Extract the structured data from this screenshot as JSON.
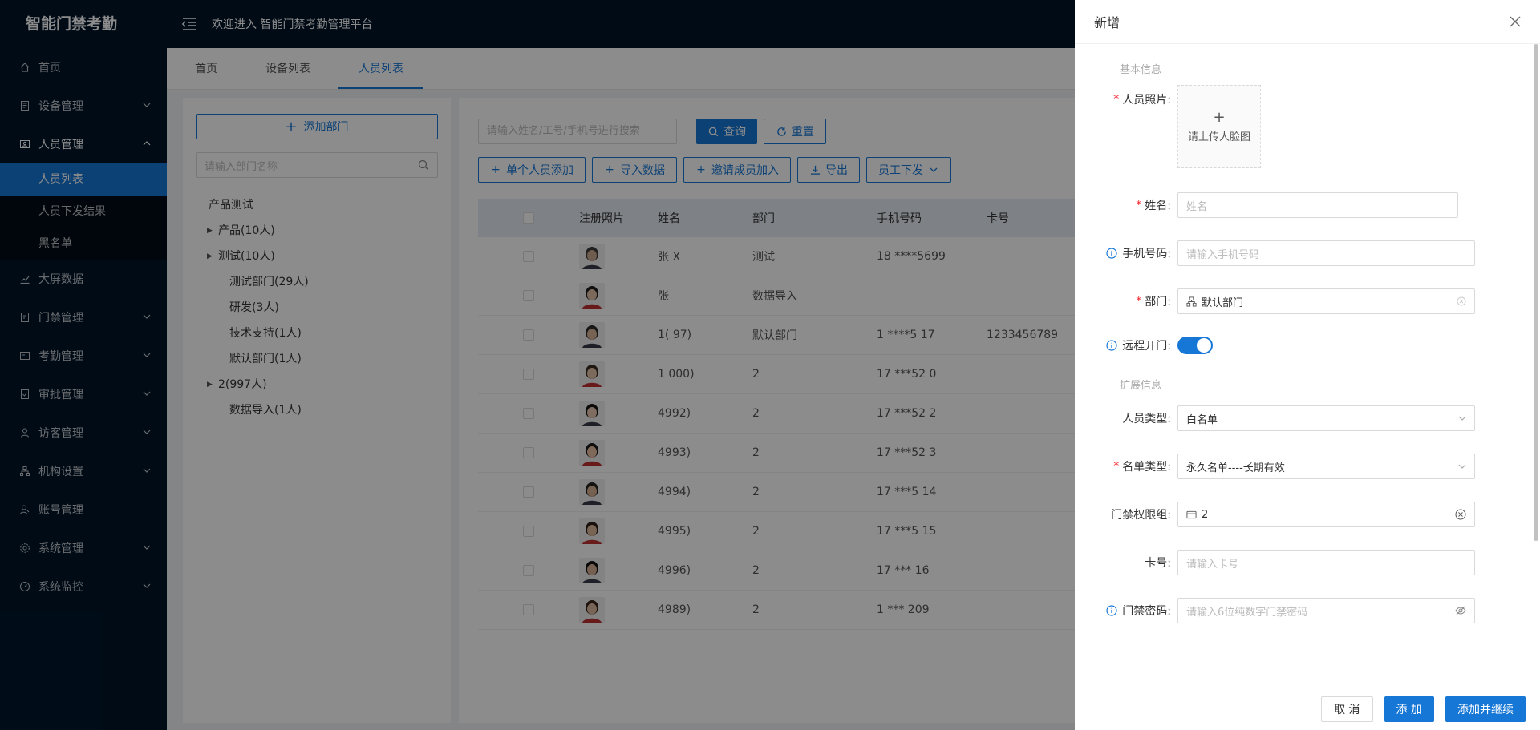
{
  "app_title": "智能门禁考勤",
  "header": {
    "welcome": "欢迎进入 智能门禁考勤管理平台"
  },
  "sidebar": {
    "items": [
      {
        "label": "首页",
        "icon": "home-icon"
      },
      {
        "label": "设备管理",
        "icon": "device-icon",
        "expandable": true
      },
      {
        "label": "人员管理",
        "icon": "person-card-icon",
        "expandable": true,
        "expanded": true,
        "children": [
          "人员列表",
          "人员下发结果",
          "黑名单"
        ]
      },
      {
        "label": "大屏数据",
        "icon": "chart-icon"
      },
      {
        "label": "门禁管理",
        "icon": "door-icon",
        "expandable": true
      },
      {
        "label": "考勤管理",
        "icon": "attendance-icon",
        "expandable": true
      },
      {
        "label": "审批管理",
        "icon": "approval-icon",
        "expandable": true
      },
      {
        "label": "访客管理",
        "icon": "visitor-icon",
        "expandable": true
      },
      {
        "label": "机构设置",
        "icon": "org-icon",
        "expandable": true
      },
      {
        "label": "账号管理",
        "icon": "account-icon"
      },
      {
        "label": "系统管理",
        "icon": "settings-icon",
        "expandable": true
      },
      {
        "label": "系统监控",
        "icon": "monitor-icon",
        "expandable": true
      }
    ],
    "active_child": "人员列表"
  },
  "tabs": [
    "首页",
    "设备列表",
    "人员列表"
  ],
  "active_tab": "人员列表",
  "dept_panel": {
    "add_button": "添加部门",
    "search_placeholder": "请输入部门名称",
    "root": "产品测试",
    "nodes": [
      {
        "label": "产品(10人)",
        "has_children": true
      },
      {
        "label": "测试(10人)",
        "has_children": true
      },
      {
        "label": "测试部门(29人)",
        "has_children": false
      },
      {
        "label": "研发(3人)",
        "has_children": false
      },
      {
        "label": "技术支持(1人)",
        "has_children": false
      },
      {
        "label": "默认部门(1人)",
        "has_children": false
      },
      {
        "label": "2(997人)",
        "has_children": true
      },
      {
        "label": "数据导入(1人)",
        "has_children": false
      }
    ]
  },
  "person_list": {
    "search_placeholder": "请输入姓名/工号/手机号进行搜索",
    "query_button": "查询",
    "reset_button": "重置",
    "actions": [
      "单个人员添加",
      "导入数据",
      "邀请成员加入",
      "导出",
      "员工下发"
    ],
    "columns": [
      "注册照片",
      "姓名",
      "部门",
      "手机号码",
      "卡号"
    ],
    "rows": [
      {
        "name": "张 X",
        "dept": "测试",
        "phone": "18 ****5699",
        "card": ""
      },
      {
        "name": "张",
        "dept": "数据导入",
        "phone": "",
        "card": ""
      },
      {
        "name": "1( 97)",
        "dept": "默认部门",
        "phone": "1 ****5 17",
        "card": "1233456789"
      },
      {
        "name": "1 000)",
        "dept": "2",
        "phone": "17 ***52 0",
        "card": ""
      },
      {
        "name": "4992)",
        "dept": "2",
        "phone": "17 ***52 2",
        "card": ""
      },
      {
        "name": "4993)",
        "dept": "2",
        "phone": "17 ***52 3",
        "card": ""
      },
      {
        "name": "4994)",
        "dept": "2",
        "phone": "17 ***5 14",
        "card": ""
      },
      {
        "name": "4995)",
        "dept": "2",
        "phone": "17 ***5 15",
        "card": ""
      },
      {
        "name": "4996)",
        "dept": "2",
        "phone": "17 *** 16",
        "card": ""
      },
      {
        "name": "4989)",
        "dept": "2",
        "phone": "1 *** 209",
        "card": ""
      }
    ]
  },
  "drawer": {
    "title": "新增",
    "section_basic": "基本信息",
    "section_ext": "扩展信息",
    "photo_label": "人员照片:",
    "photo_upload_text": "请上传人脸图",
    "name_label": "姓名:",
    "name_placeholder": "姓名",
    "phone_label": "手机号码:",
    "phone_placeholder": "请输入手机号码",
    "dept_label": "部门:",
    "dept_value": "默认部门",
    "remote_label": "远程开门:",
    "remote_on": true,
    "type_label": "人员类型:",
    "type_value": "白名单",
    "list_type_label": "名单类型:",
    "list_type_value": "永久名单----长期有效",
    "access_group_label": "门禁权限组:",
    "access_group_value": "2",
    "card_label": "卡号:",
    "card_placeholder": "请输入卡号",
    "pwd_label": "门禁密码:",
    "pwd_placeholder": "请输入6位纯数字门禁密码",
    "cancel": "取 消",
    "add": "添 加",
    "add_continue": "添加并继续"
  },
  "colors": {
    "primary": "#1677d6",
    "sidebar_bg": "#001529",
    "required": "#f5222d"
  }
}
